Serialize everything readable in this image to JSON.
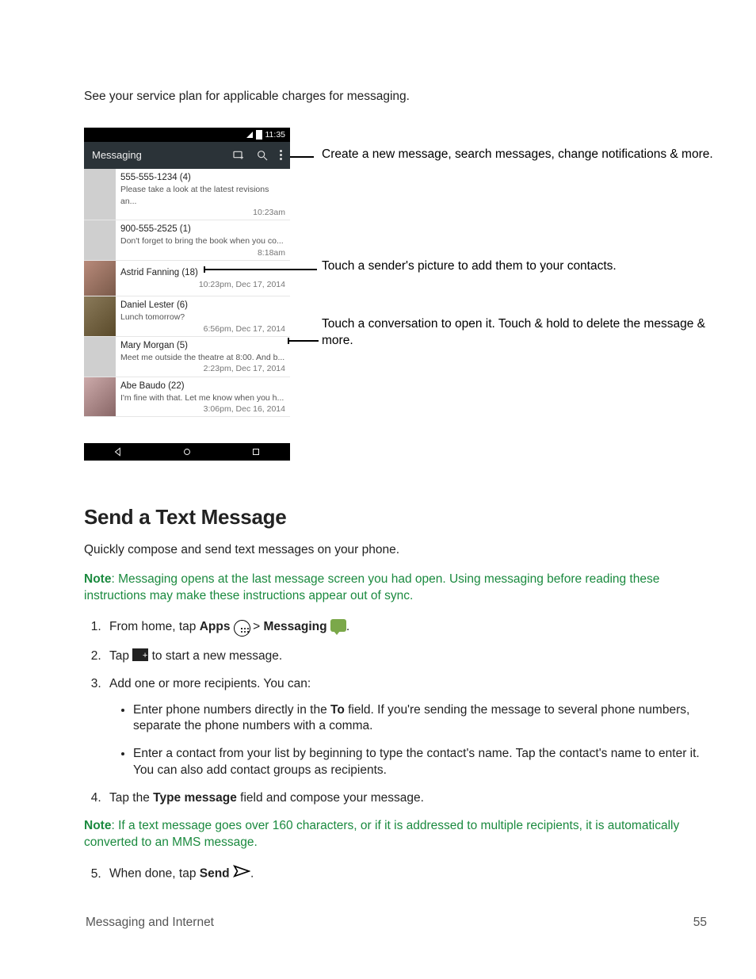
{
  "intro": "See your service plan for applicable charges for messaging.",
  "phone": {
    "status_time": "11:35",
    "appbar_title": "Messaging",
    "threads": [
      {
        "sender": "555-555-1234 (4)",
        "preview": "Please take a look at the latest revisions an...",
        "time": "10:23am",
        "avatar": ""
      },
      {
        "sender": "900-555-2525 (1)",
        "preview": "Don't forget to bring the book when you co...",
        "time": "8:18am",
        "avatar": ""
      },
      {
        "sender": "Astrid Fanning (18)",
        "preview": "",
        "time": "10:23pm, Dec 17, 2014",
        "avatar": "p1"
      },
      {
        "sender": "Daniel Lester (6)",
        "preview": "Lunch tomorrow?",
        "time": "6:56pm, Dec 17, 2014",
        "avatar": "p2"
      },
      {
        "sender": "Mary Morgan (5)",
        "preview": "Meet me outside the theatre at 8:00. And b...",
        "time": "2:23pm, Dec 17, 2014",
        "avatar": ""
      },
      {
        "sender": "Abe Baudo (22)",
        "preview": "I'm fine with that. Let me know when you h...",
        "time": "3:06pm, Dec 16, 2014",
        "avatar": "p3"
      }
    ]
  },
  "callouts": {
    "c1": "Create a new message, search messages, change notifications & more.",
    "c2": "Touch a sender's picture to add them to your contacts.",
    "c3": "Touch  a conversation to open it. Touch & hold to delete the message & more."
  },
  "section_heading": "Send a Text Message",
  "section_intro": "Quickly compose and send text messages on your phone.",
  "note1_label": "Note",
  "note1_body": ": Messaging opens at the last message screen you had open. Using messaging before reading these instructions may make these instructions appear out of sync.",
  "steps": {
    "s1_a": "From home, tap ",
    "s1_apps": "Apps",
    "s1_gt": " > ",
    "s1_msg": "Messaging",
    "s1_dot": ".",
    "s2_a": "Tap ",
    "s2_b": " to start a new message.",
    "s3": "Add one or more recipients. You can:",
    "s3_sub1_a": "Enter phone numbers directly in the ",
    "s3_sub1_to": "To",
    "s3_sub1_b": " field. If you're sending the message to several phone numbers, separate the phone numbers with a comma.",
    "s3_sub2": "Enter a contact from your list by beginning to type the contact's name. Tap the contact's name to enter it. You can also add contact groups as recipients.",
    "s4_a": "Tap the ",
    "s4_field": "Type message",
    "s4_b": " field and compose your message.",
    "s5_a": "When done, tap ",
    "s5_send": "Send",
    "s5_dot": "."
  },
  "note2_label": "Note",
  "note2_body": ": If a text message goes over 160 characters, or if it is addressed to multiple recipients, it is automatically converted to an MMS message.",
  "footer_left": "Messaging and Internet",
  "footer_right": "55"
}
